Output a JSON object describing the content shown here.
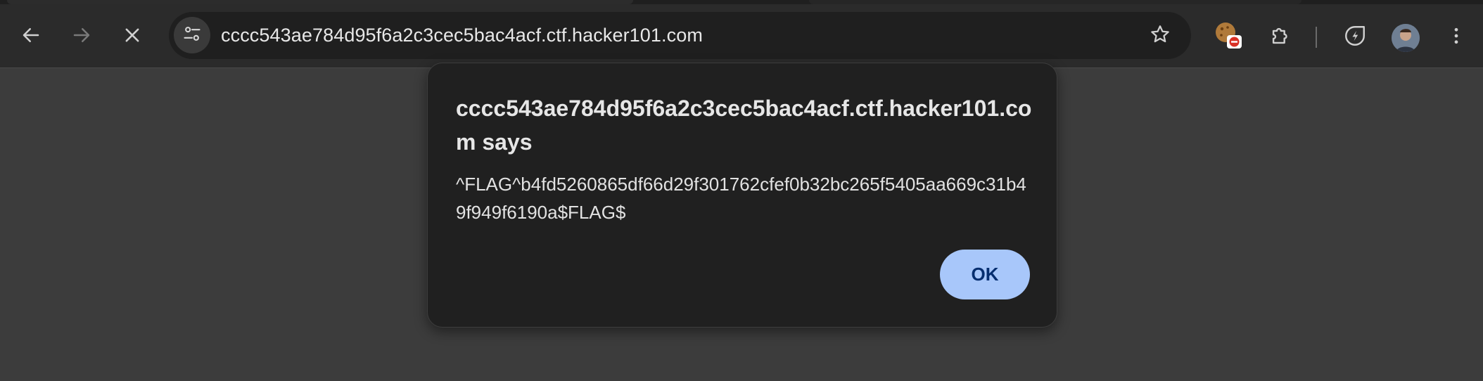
{
  "browser": {
    "url": "cccc543ae784d95f6a2c3cec5bac4acf.ctf.hacker101.com",
    "icons": {
      "back": "arrow-left-icon",
      "forward": "arrow-right-icon",
      "stop": "close-icon",
      "site_info": "tune-icon",
      "bookmark": "star-icon",
      "extension_1": "cookie-blocked-icon",
      "extension_2": "puzzle-icon",
      "performance": "leaf-bolt-icon",
      "menu": "more-vertical-icon"
    },
    "colors": {
      "toolbar": "#2b2b2b",
      "omnibox": "#1f1f1f",
      "page_background": "#3c3c3c"
    }
  },
  "dialog": {
    "title": "cccc543ae784d95f6a2c3cec5bac4acf.ctf.hacker101.com says",
    "message": "^FLAG^b4fd5260865df66d29f301762cfef0b32bc265f5405aa669c31b49f949f6190a$FLAG$",
    "ok_label": "OK",
    "colors": {
      "background": "#202020",
      "button": "#a8c7fa",
      "button_text": "#062e6f"
    }
  }
}
